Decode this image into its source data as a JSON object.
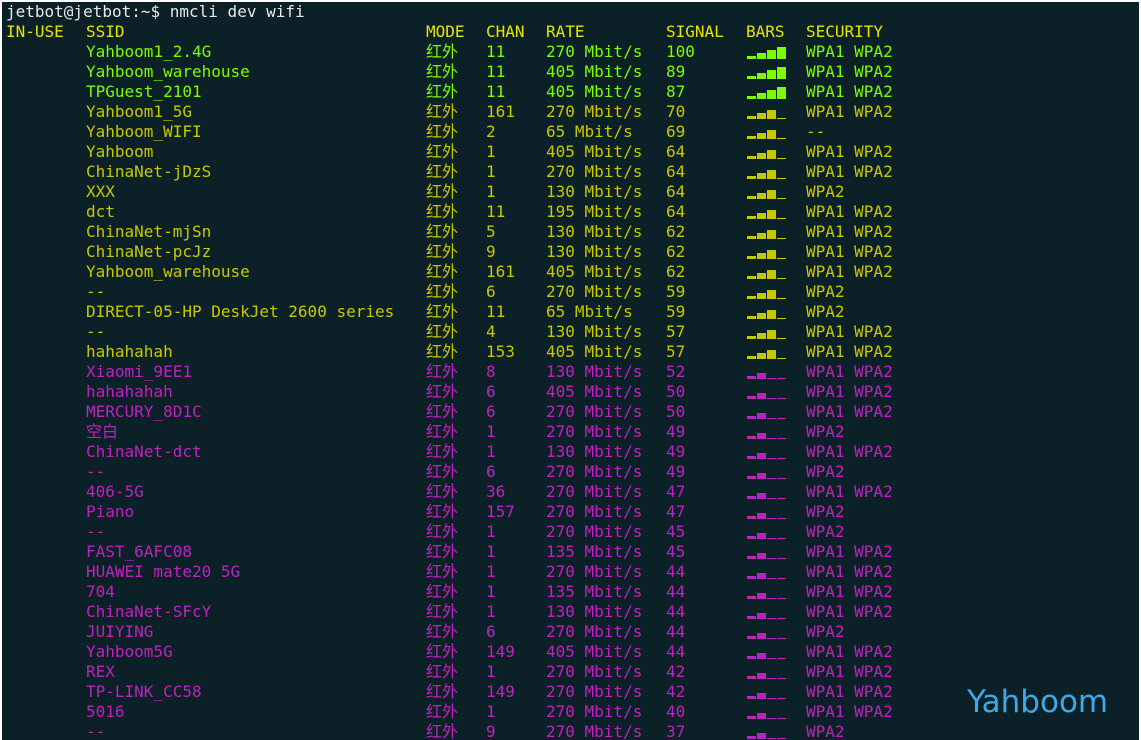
{
  "terminal": {
    "prompt": "jetbot@jetbot:~$ nmcli dev wifi",
    "headers": {
      "in_use": "IN-USE",
      "ssid": "SSID",
      "mode": "MODE",
      "chan": "CHAN",
      "rate": "RATE",
      "signal": "SIGNAL",
      "bars": "BARS",
      "security": "SECURITY"
    },
    "colors": {
      "green": "#7cfc00",
      "yellow": "#c8c800",
      "magenta": "#c020c0",
      "header": "#e5e600",
      "background": "#0c2027"
    },
    "networks": [
      {
        "ssid": "Yahboom1_2.4G",
        "mode": "红外",
        "chan": "11",
        "rate": "270 Mbit/s",
        "signal": "100",
        "bars": 4,
        "security": "WPA1 WPA2",
        "tier": "g"
      },
      {
        "ssid": "Yahboom_warehouse",
        "mode": "红外",
        "chan": "11",
        "rate": "405 Mbit/s",
        "signal": "89",
        "bars": 4,
        "security": "WPA1 WPA2",
        "tier": "g"
      },
      {
        "ssid": "TPGuest_2101",
        "mode": "红外",
        "chan": "11",
        "rate": "405 Mbit/s",
        "signal": "87",
        "bars": 4,
        "security": "WPA1 WPA2",
        "tier": "g"
      },
      {
        "ssid": "Yahboom1_5G",
        "mode": "红外",
        "chan": "161",
        "rate": "270 Mbit/s",
        "signal": "70",
        "bars": 3,
        "security": "WPA1 WPA2",
        "tier": "y"
      },
      {
        "ssid": "Yahboom_WIFI",
        "mode": "红外",
        "chan": "2",
        "rate": "65 Mbit/s",
        "signal": "69",
        "bars": 3,
        "security": "--",
        "tier": "y"
      },
      {
        "ssid": "Yahboom",
        "mode": "红外",
        "chan": "1",
        "rate": "405 Mbit/s",
        "signal": "64",
        "bars": 3,
        "security": "WPA1 WPA2",
        "tier": "y"
      },
      {
        "ssid": "ChinaNet-jDzS",
        "mode": "红外",
        "chan": "1",
        "rate": "270 Mbit/s",
        "signal": "64",
        "bars": 3,
        "security": "WPA1 WPA2",
        "tier": "y"
      },
      {
        "ssid": "XXX",
        "mode": "红外",
        "chan": "1",
        "rate": "130 Mbit/s",
        "signal": "64",
        "bars": 3,
        "security": "WPA2",
        "tier": "y"
      },
      {
        "ssid": "dct",
        "mode": "红外",
        "chan": "11",
        "rate": "195 Mbit/s",
        "signal": "64",
        "bars": 3,
        "security": "WPA1 WPA2",
        "tier": "y"
      },
      {
        "ssid": "ChinaNet-mjSn",
        "mode": "红外",
        "chan": "5",
        "rate": "130 Mbit/s",
        "signal": "62",
        "bars": 3,
        "security": "WPA1 WPA2",
        "tier": "y"
      },
      {
        "ssid": "ChinaNet-pcJz",
        "mode": "红外",
        "chan": "9",
        "rate": "130 Mbit/s",
        "signal": "62",
        "bars": 3,
        "security": "WPA1 WPA2",
        "tier": "y"
      },
      {
        "ssid": "Yahboom_warehouse",
        "mode": "红外",
        "chan": "161",
        "rate": "405 Mbit/s",
        "signal": "62",
        "bars": 3,
        "security": "WPA1 WPA2",
        "tier": "y"
      },
      {
        "ssid": "--",
        "mode": "红外",
        "chan": "6",
        "rate": "270 Mbit/s",
        "signal": "59",
        "bars": 3,
        "security": "WPA2",
        "tier": "y"
      },
      {
        "ssid": "DIRECT-05-HP DeskJet 2600 series",
        "mode": "红外",
        "chan": "11",
        "rate": "65 Mbit/s",
        "signal": "59",
        "bars": 3,
        "security": "WPA2",
        "tier": "y"
      },
      {
        "ssid": "--",
        "mode": "红外",
        "chan": "4",
        "rate": "130 Mbit/s",
        "signal": "57",
        "bars": 3,
        "security": "WPA1 WPA2",
        "tier": "y"
      },
      {
        "ssid": "hahahahah",
        "mode": "红外",
        "chan": "153",
        "rate": "405 Mbit/s",
        "signal": "57",
        "bars": 3,
        "security": "WPA1 WPA2",
        "tier": "y"
      },
      {
        "ssid": "Xiaomi_9EE1",
        "mode": "红外",
        "chan": "8",
        "rate": "130 Mbit/s",
        "signal": "52",
        "bars": 2,
        "security": "WPA1 WPA2",
        "tier": "m"
      },
      {
        "ssid": "hahahahah",
        "mode": "红外",
        "chan": "6",
        "rate": "405 Mbit/s",
        "signal": "50",
        "bars": 2,
        "security": "WPA1 WPA2",
        "tier": "m"
      },
      {
        "ssid": "MERCURY_8D1C",
        "mode": "红外",
        "chan": "6",
        "rate": "270 Mbit/s",
        "signal": "50",
        "bars": 2,
        "security": "WPA1 WPA2",
        "tier": "m"
      },
      {
        "ssid": "空白",
        "mode": "红外",
        "chan": "1",
        "rate": "270 Mbit/s",
        "signal": "49",
        "bars": 2,
        "security": "WPA2",
        "tier": "m"
      },
      {
        "ssid": "ChinaNet-dct",
        "mode": "红外",
        "chan": "1",
        "rate": "130 Mbit/s",
        "signal": "49",
        "bars": 2,
        "security": "WPA1 WPA2",
        "tier": "m"
      },
      {
        "ssid": "--",
        "mode": "红外",
        "chan": "6",
        "rate": "270 Mbit/s",
        "signal": "49",
        "bars": 2,
        "security": "WPA2",
        "tier": "m"
      },
      {
        "ssid": "406-5G",
        "mode": "红外",
        "chan": "36",
        "rate": "270 Mbit/s",
        "signal": "47",
        "bars": 2,
        "security": "WPA1 WPA2",
        "tier": "m"
      },
      {
        "ssid": "Piano",
        "mode": "红外",
        "chan": "157",
        "rate": "270 Mbit/s",
        "signal": "47",
        "bars": 2,
        "security": "WPA2",
        "tier": "m"
      },
      {
        "ssid": "--",
        "mode": "红外",
        "chan": "1",
        "rate": "270 Mbit/s",
        "signal": "45",
        "bars": 2,
        "security": "WPA2",
        "tier": "m"
      },
      {
        "ssid": "FAST_6AFC08",
        "mode": "红外",
        "chan": "1",
        "rate": "135 Mbit/s",
        "signal": "45",
        "bars": 2,
        "security": "WPA1 WPA2",
        "tier": "m"
      },
      {
        "ssid": "HUAWEI mate20 5G",
        "mode": "红外",
        "chan": "1",
        "rate": "270 Mbit/s",
        "signal": "44",
        "bars": 2,
        "security": "WPA1 WPA2",
        "tier": "m"
      },
      {
        "ssid": "704",
        "mode": "红外",
        "chan": "1",
        "rate": "135 Mbit/s",
        "signal": "44",
        "bars": 2,
        "security": "WPA1 WPA2",
        "tier": "m"
      },
      {
        "ssid": "ChinaNet-SFcY",
        "mode": "红外",
        "chan": "1",
        "rate": "130 Mbit/s",
        "signal": "44",
        "bars": 2,
        "security": "WPA1 WPA2",
        "tier": "m"
      },
      {
        "ssid": "JUIYING",
        "mode": "红外",
        "chan": "6",
        "rate": "270 Mbit/s",
        "signal": "44",
        "bars": 2,
        "security": "WPA2",
        "tier": "m"
      },
      {
        "ssid": "Yahboom5G",
        "mode": "红外",
        "chan": "149",
        "rate": "405 Mbit/s",
        "signal": "44",
        "bars": 2,
        "security": "WPA1 WPA2",
        "tier": "m"
      },
      {
        "ssid": "REX",
        "mode": "红外",
        "chan": "1",
        "rate": "270 Mbit/s",
        "signal": "42",
        "bars": 2,
        "security": "WPA1 WPA2",
        "tier": "m"
      },
      {
        "ssid": "TP-LINK_CC58",
        "mode": "红外",
        "chan": "149",
        "rate": "270 Mbit/s",
        "signal": "42",
        "bars": 2,
        "security": "WPA1 WPA2",
        "tier": "m"
      },
      {
        "ssid": "5016",
        "mode": "红外",
        "chan": "1",
        "rate": "270 Mbit/s",
        "signal": "40",
        "bars": 2,
        "security": "WPA1 WPA2",
        "tier": "m"
      },
      {
        "ssid": "--",
        "mode": "红外",
        "chan": "9",
        "rate": "270 Mbit/s",
        "signal": "37",
        "bars": 2,
        "security": "WPA2",
        "tier": "m"
      }
    ]
  },
  "watermark": {
    "text": "Yahboom",
    "color": "#3fa8e8"
  }
}
